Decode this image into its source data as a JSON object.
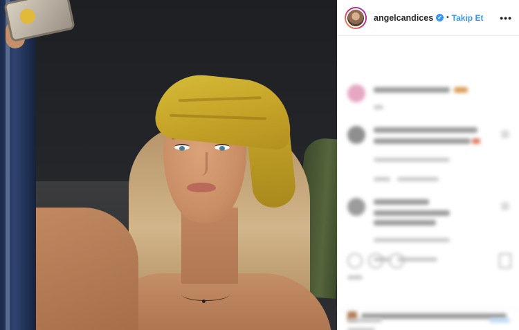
{
  "post": {
    "username": "angelcandices",
    "verified_icon": "verified-badge-icon",
    "separator": "•",
    "follow_label": "Takip Et",
    "more_icon": "more-horizontal-icon",
    "more_glyph": "•••",
    "check_glyph": "✓"
  },
  "colors": {
    "accent": "#3897f0",
    "text": "#262626",
    "divider": "#efefef"
  }
}
